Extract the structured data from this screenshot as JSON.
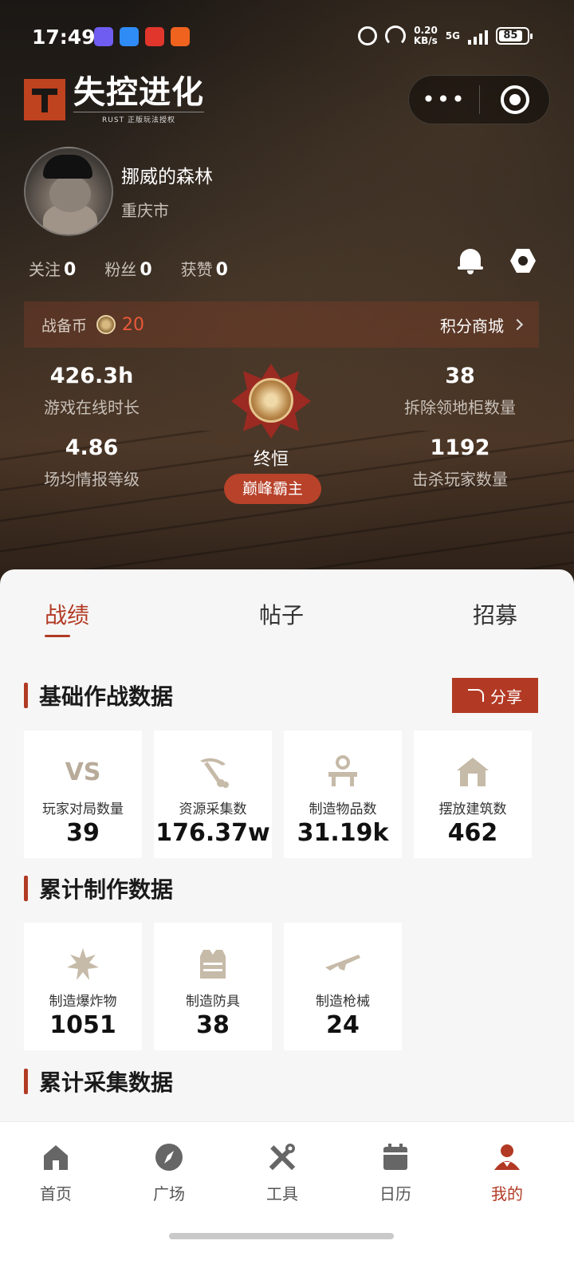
{
  "status_bar": {
    "time": "17:49",
    "net_speed": "0.20",
    "net_unit": "KB/s",
    "network": "5G",
    "battery": "85"
  },
  "app": {
    "logo_title": "失控进化",
    "logo_subtitle": "RUST 正版玩法授权",
    "accent_color": "#b23a24"
  },
  "profile": {
    "username": "挪威的森林",
    "location": "重庆市",
    "following_label": "关注",
    "following_count": "0",
    "followers_label": "粉丝",
    "followers_count": "0",
    "likes_label": "获赞",
    "likes_count": "0"
  },
  "coins": {
    "label": "战备币",
    "value": "20",
    "mall_label": "积分商城"
  },
  "stats": {
    "online_time_value": "426.3h",
    "online_time_label": "游戏在线时长",
    "intel_level_value": "4.86",
    "intel_level_label": "场均情报等级",
    "cabinets_value": "38",
    "cabinets_label": "拆除领地柜数量",
    "kills_value": "1192",
    "kills_label": "击杀玩家数量",
    "medal_name": "终恒",
    "rank_title": "巅峰霸主"
  },
  "tabs": [
    {
      "label": "战绩"
    },
    {
      "label": "帖子"
    },
    {
      "label": "招募"
    }
  ],
  "basic_section": {
    "title": "基础作战数据",
    "share_label": "分享",
    "cards": [
      {
        "icon": "vs-icon",
        "icon_text": "VS",
        "label": "玩家对局数量",
        "value": "39"
      },
      {
        "icon": "pickaxe-icon",
        "label": "资源采集数",
        "value": "176.37w"
      },
      {
        "icon": "workbench-icon",
        "label": "制造物品数",
        "value": "31.19k"
      },
      {
        "icon": "house-icon",
        "label": "摆放建筑数",
        "value": "462"
      }
    ]
  },
  "craft_section": {
    "title": "累计制作数据",
    "cards": [
      {
        "icon": "explosive-icon",
        "label": "制造爆炸物",
        "value": "1051"
      },
      {
        "icon": "armor-icon",
        "label": "制造防具",
        "value": "38"
      },
      {
        "icon": "rifle-icon",
        "label": "制造枪械",
        "value": "24"
      }
    ]
  },
  "gather_section": {
    "title": "累计采集数据"
  },
  "bottom_nav": [
    {
      "icon": "home-icon",
      "label": "首页"
    },
    {
      "icon": "compass-icon",
      "label": "广场"
    },
    {
      "icon": "tools-icon",
      "label": "工具"
    },
    {
      "icon": "calendar-icon",
      "label": "日历"
    },
    {
      "icon": "profile-icon",
      "label": "我的",
      "active": true
    }
  ]
}
